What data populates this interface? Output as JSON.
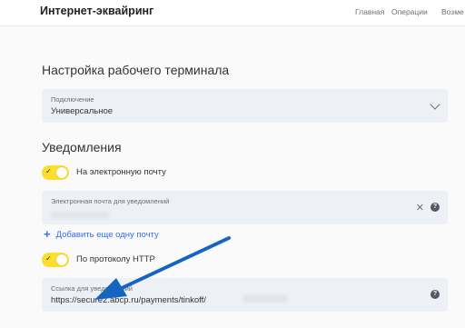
{
  "header": {
    "title": "Интернет-эквайринг",
    "nav": [
      "Главная",
      "Операции",
      "Возме"
    ]
  },
  "terminal": {
    "title": "Настройка рабочего терминала",
    "connection": {
      "label": "Подключение",
      "value": "Универсальное",
      "icon": "chevron-down-icon"
    }
  },
  "notifications": {
    "title": "Уведомления",
    "email_toggle": {
      "label": "На электронную почту",
      "enabled": true,
      "icon": "check-icon"
    },
    "email_field": {
      "label": "Электронная почта для уведомлений",
      "value_hidden": true,
      "clear_icon": "close-icon",
      "help_icon": "help-icon"
    },
    "add_email": {
      "label": "Добавить еще одну почту",
      "icon": "plus-icon"
    },
    "http_toggle": {
      "label": "По протоколу HTTP",
      "enabled": true,
      "icon": "check-icon"
    },
    "http_field": {
      "label": "Ссылка для уведомлений",
      "value": "https://secure2.abcp.ru/payments/tinkoff/",
      "help_icon": "help-icon"
    }
  },
  "annotation": {
    "icon": "arrow-icon",
    "color": "#1565c0"
  },
  "colors": {
    "accent": "#ffdd2d",
    "link": "#336fee",
    "field_bg": "#edf1f6"
  }
}
